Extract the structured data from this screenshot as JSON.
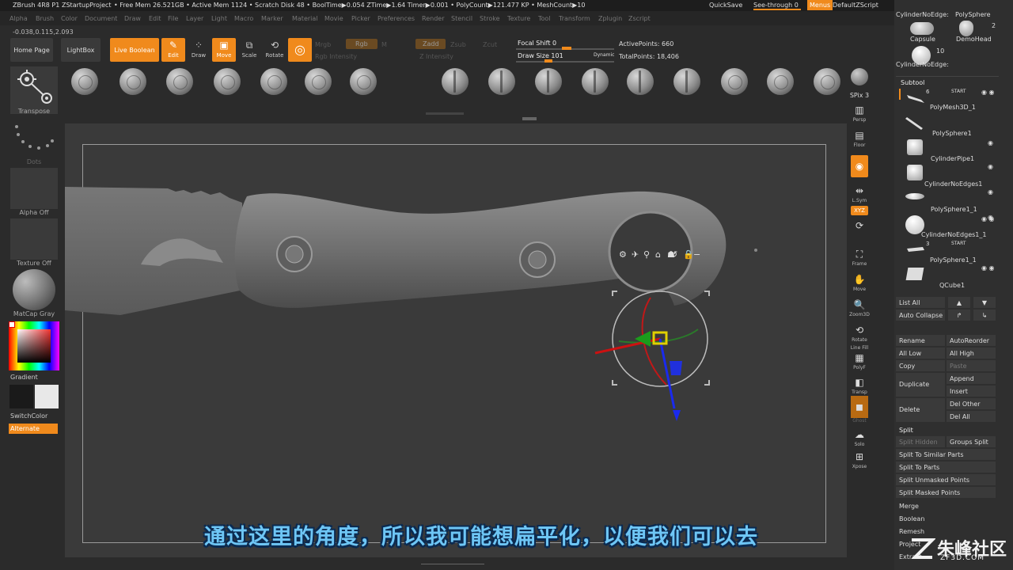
{
  "titlebar": {
    "app": "ZBrush 4R8 P1",
    "project": "ZStartupProject",
    "stats": "• Free Mem 26.521GB • Active Mem 1124 • Scratch Disk 48 • BoolTime▶0.054 ZTime▶1.64 Timer▶0.001 • PolyCount▶121.477 KP • MeshCount▶10",
    "quicksave": "QuickSave",
    "seethrough": "See-through  0",
    "menus": "Menus",
    "defaultzscript": "DefaultZScript"
  },
  "menubar": [
    "Alpha",
    "Brush",
    "Color",
    "Document",
    "Draw",
    "Edit",
    "File",
    "Layer",
    "Light",
    "Macro",
    "Marker",
    "Material",
    "Movie",
    "Picker",
    "Preferences",
    "Render",
    "Stencil",
    "Stroke",
    "Texture",
    "Tool",
    "Transform",
    "Zplugin",
    "Zscript"
  ],
  "coords": "-0.038,0.115,2.093",
  "toolbar": {
    "home_page": "Home Page",
    "lightbox": "LightBox",
    "live_boolean": "Live Boolean",
    "edit": "Edit",
    "draw": "Draw",
    "move": "Move",
    "scale": "Scale",
    "rotate": "Rotate",
    "mrgb": "Mrgb",
    "rgb": "Rgb",
    "m": "M",
    "zadd": "Zadd",
    "zsub": "Zsub",
    "zcut": "Zcut",
    "rgb_intensity": "Rgb Intensity",
    "z_intensity": "Z Intensity",
    "focal_shift": "Focal Shift 0",
    "draw_size": "Draw Size 101",
    "dynamic": "Dynamic",
    "active_points": "ActivePoints: 660",
    "total_points": "TotalPoints: 18,406"
  },
  "left_tray": {
    "transpose": "Transpose",
    "dots": "Dots",
    "alpha_off": "Alpha Off",
    "texture_off": "Texture Off",
    "matcap": "MatCap Gray",
    "gradient": "Gradient",
    "switchcolor": "SwitchColor",
    "alternate": "Alternate"
  },
  "right_shelf": [
    {
      "label": "SPix 3",
      "icon": "spix-icon"
    },
    {
      "label": "Persp",
      "icon": "persp-icon"
    },
    {
      "label": "Floor",
      "icon": "floor-icon"
    },
    {
      "label": "Local",
      "icon": "local-icon"
    },
    {
      "label": "L.Sym",
      "icon": "lsym-icon"
    },
    {
      "label": "Gxyz",
      "icon": "xyz-icon"
    },
    {
      "label": "Frame",
      "icon": "frame-icon"
    },
    {
      "label": "Move",
      "icon": "move-icon"
    },
    {
      "label": "Zoom3D",
      "icon": "zoom3d-icon"
    },
    {
      "label": "Rotate",
      "icon": "rotate-icon"
    },
    {
      "label": "PolyF",
      "icon": "polyf-icon"
    },
    {
      "label": "Transp",
      "icon": "transp-icon"
    },
    {
      "label": "Ghost",
      "icon": "ghost-icon"
    },
    {
      "label": "Solo",
      "icon": "solo-icon"
    },
    {
      "label": "Xpose",
      "icon": "xpose-icon"
    }
  ],
  "line_fill": "Line Fill",
  "tool_palette": {
    "top_names": [
      "CylinderNoEdge:",
      "PolySphere",
      "Capsule",
      "DemoHead",
      "CylinderNoEdge:"
    ],
    "counts": [
      "2",
      "10"
    ]
  },
  "subtool": {
    "header": "Subtool",
    "items": [
      {
        "name": "",
        "count": "6",
        "start": "START"
      },
      {
        "name": "PolyMesh3D_1"
      },
      {
        "name": "PolySphere1"
      },
      {
        "name": "CylinderPipe1"
      },
      {
        "name": "CylinderNoEdges1"
      },
      {
        "name": "PolySphere1_1"
      },
      {
        "name": "CylinderNoEdges1_1"
      },
      {
        "name": "",
        "count": "3",
        "start": "START"
      },
      {
        "name": "PolySphere1_1"
      },
      {
        "name": "QCube1"
      }
    ],
    "buttons": {
      "list_all": "List All",
      "auto_collapse": "Auto Collapse",
      "rename": "Rename",
      "autoreorder": "AutoReorder",
      "all_low": "All Low",
      "all_high": "All High",
      "copy": "Copy",
      "paste": "Paste",
      "duplicate": "Duplicate",
      "append": "Append",
      "insert": "Insert",
      "delete": "Delete",
      "del_other": "Del Other",
      "del_all": "Del All"
    },
    "split": {
      "header": "Split",
      "split_hidden": "Split Hidden",
      "groups_split": "Groups Split",
      "to_similar": "Split To Similar Parts",
      "to_parts": "Split To Parts",
      "unmasked": "Split Unmasked Points",
      "masked": "Split Masked Points"
    },
    "merge": "Merge",
    "boolean": "Boolean",
    "remesh": "Remesh",
    "project": "Project",
    "extract": "Extract"
  },
  "subtitle": "通过这里的角度，所以我可能想扁平化，以便我们可以去",
  "watermark": {
    "name": "朱峰社区",
    "url": "ZF3D.COM"
  },
  "colors": {
    "accent": "#f08a1c",
    "background": "#2b2b2b",
    "subtitle": "#6ec6f5"
  }
}
